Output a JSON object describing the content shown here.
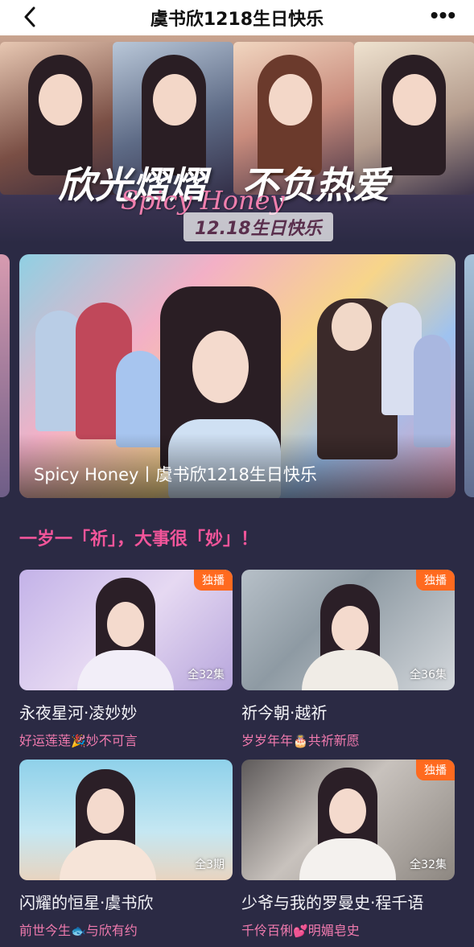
{
  "topbar": {
    "title": "虞书欣1218生日快乐",
    "back_icon": "chevron-left-icon",
    "more_icon": "more-dots-icon",
    "more_label": "•••"
  },
  "hero": {
    "headline_left": "欣光熠熠",
    "headline_right": "不负热爱",
    "subtitle_en": "Spicy Honey",
    "date_label": "12.18生日快乐"
  },
  "feature": {
    "caption": "Spicy Honey丨虞书欣1218生日快乐"
  },
  "section": {
    "title": "一岁一「祈」，大事很「妙」！"
  },
  "cards": [
    {
      "badge": "独播",
      "count": "全32集",
      "name": "永夜星河·凌妙妙",
      "sub_a": "好运莲莲",
      "emoji": "🎉",
      "sub_b": "妙不可言",
      "accent": "#c9b8e6"
    },
    {
      "badge": "独播",
      "count": "全36集",
      "name": "祈今朝·越祈",
      "sub_a": "岁岁年年",
      "emoji": "🎂",
      "sub_b": "共祈新愿",
      "accent": "#9aa3aa"
    },
    {
      "badge": "",
      "count": "全3期",
      "name": "闪耀的恒星·虞书欣",
      "sub_a": "前世今生",
      "emoji": "🐟",
      "sub_b": "与欣有约",
      "accent": "#9fd3e8"
    },
    {
      "badge": "独播",
      "count": "全32集",
      "name": "少爷与我的罗曼史·程千语",
      "sub_a": "千伶百俐",
      "emoji": "💕",
      "sub_b": "明媚皂史",
      "accent": "#cfc9c6"
    }
  ],
  "colors": {
    "background": "#2b2a44",
    "accent_pink": "#f2559a",
    "badge_orange": "#ff6a1f"
  }
}
